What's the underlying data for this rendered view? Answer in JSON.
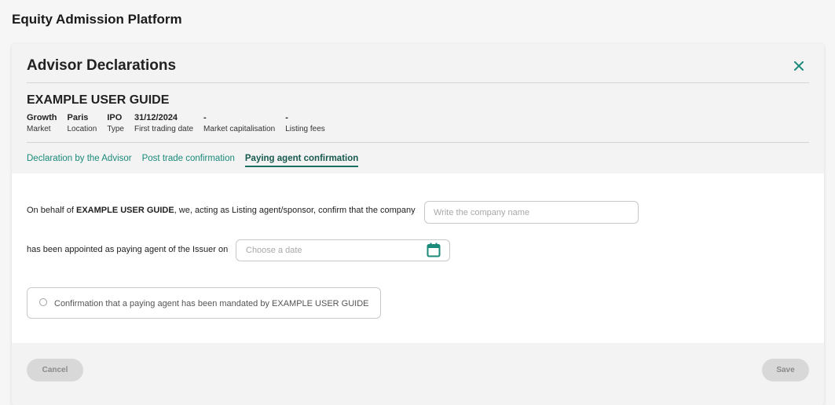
{
  "app": {
    "title": "Equity Admission Platform"
  },
  "modal": {
    "title": "Advisor Declarations",
    "close_icon": "close-icon",
    "accent_color": "#1a8a7a"
  },
  "company": {
    "name": "EXAMPLE USER GUIDE",
    "meta": [
      {
        "value": "Growth",
        "label": "Market"
      },
      {
        "value": "Paris",
        "label": "Location"
      },
      {
        "value": "IPO",
        "label": "Type"
      },
      {
        "value": "31/12/2024",
        "label": "First trading date"
      },
      {
        "value": "-",
        "label": "Market capitalisation"
      },
      {
        "value": "-",
        "label": "Listing fees"
      }
    ]
  },
  "tabs": [
    {
      "label": "Declaration by the Advisor",
      "active": false
    },
    {
      "label": "Post trade confirmation",
      "active": false
    },
    {
      "label": "Paying agent confirmation",
      "active": true
    }
  ],
  "form": {
    "line1_prefix": "On behalf of ",
    "line1_company": "EXAMPLE USER GUIDE",
    "line1_suffix": ", we, acting as Listing agent/sponsor, confirm that the company",
    "company_input": {
      "value": "",
      "placeholder": "Write the company name"
    },
    "line2": "has been appointed as paying agent of the Issuer on",
    "date_input": {
      "value": "",
      "placeholder": "Choose a date",
      "icon": "calendar-icon"
    },
    "confirmation": {
      "label": "Confirmation that a paying agent has been mandated by EXAMPLE USER GUIDE",
      "checked": false
    }
  },
  "footer": {
    "cancel_label": "Cancel",
    "save_label": "Save"
  }
}
